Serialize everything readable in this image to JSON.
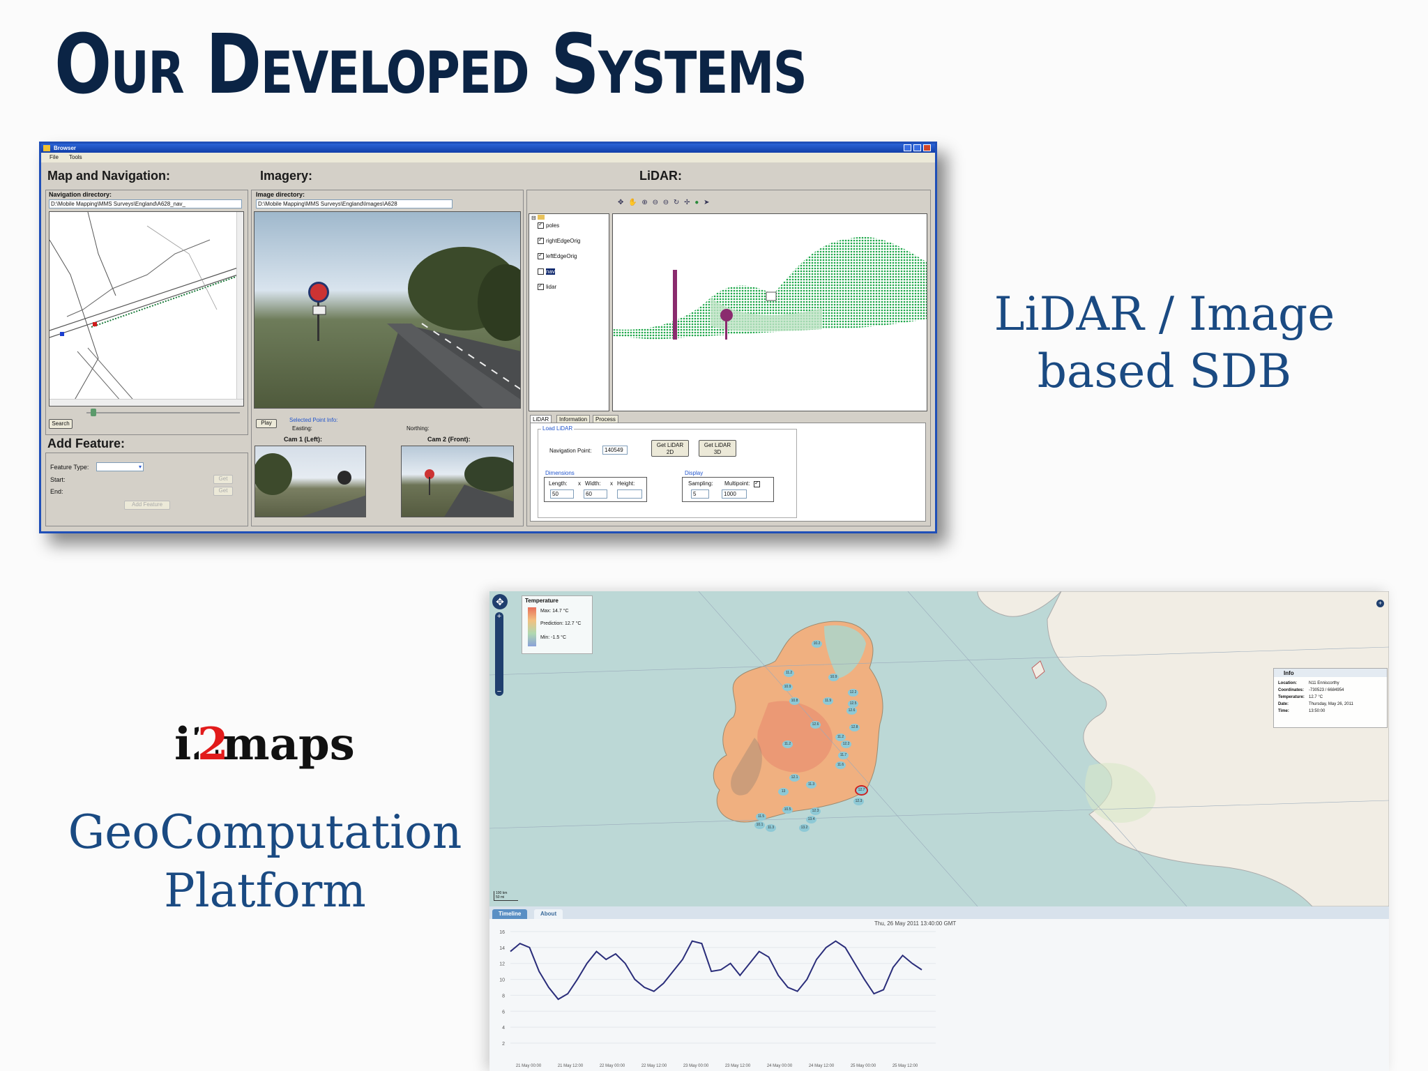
{
  "slide": {
    "title": "Our Developed Systems",
    "lidar_caption_line1": "LiDAR / Image",
    "lidar_caption_line2": "based SDB",
    "i2maps_logo": "i2maps",
    "platform_line1": "GeoComputation",
    "platform_line2": "Platform"
  },
  "browser_app": {
    "window_title": "Browser",
    "menu": [
      "File",
      "Tools"
    ],
    "map_nav": {
      "heading": "Map and Navigation:",
      "dir_label": "Navigation directory:",
      "dir_value": "D:\\Mobile Mapping\\MMS Surveys\\England\\A628_nav_",
      "search_button": "Search"
    },
    "add_feature": {
      "heading": "Add Feature:",
      "feature_type_label": "Feature Type:",
      "start_label": "Start:",
      "end_label": "End:",
      "get_button": "Get",
      "add_button": "Add Feature"
    },
    "imagery": {
      "heading": "Imagery:",
      "dir_label": "Image directory:",
      "dir_value": "D:\\Mobile Mapping\\MMS Surveys\\England\\Images\\A628",
      "play_button": "Play",
      "selected_point_label": "Selected Point Info:",
      "easting_label": "Easting:",
      "northing_label": "Northing:",
      "cam1_label": "Cam 1 (Left):",
      "cam2_label": "Cam 2 (Front):"
    },
    "lidar": {
      "heading": "LiDAR:",
      "layers": [
        {
          "name": "poles",
          "checked": true
        },
        {
          "name": "rightEdgeOrig",
          "checked": true
        },
        {
          "name": "leftEdgeOrig",
          "checked": true
        },
        {
          "name": "nav",
          "checked": false
        },
        {
          "name": "lidar",
          "checked": true
        }
      ],
      "tabs": [
        "LiDAR",
        "Information",
        "Process"
      ],
      "load_group": "Load LiDAR",
      "nav_point_label": "Navigation Point:",
      "nav_point_value": "140549",
      "get2d_line1": "Get LiDAR",
      "get2d_line2": "2D",
      "get3d_line1": "Get LiDAR",
      "get3d_line2": "3D",
      "dimensions_group": "Dimensions",
      "length_label": "Length:",
      "width_label": "Width:",
      "height_label": "Height:",
      "x_sep": "x",
      "length_value": "50",
      "width_value": "60",
      "height_value": "",
      "display_group": "Display",
      "sampling_label": "Sampling:",
      "sampling_value": "5",
      "multipoint_label": "Multipoint:",
      "multipoint_value": "1000"
    }
  },
  "i2maps_app": {
    "legend": {
      "title": "Temperature",
      "max": "Max: 14.7 °C",
      "prediction": "Prediction: 12.7 °C",
      "min": "Min: -1.5 °C"
    },
    "info": {
      "title": "Info",
      "rows": [
        {
          "k": "Location:",
          "v": "N11 Enniscorthy"
        },
        {
          "k": "Coordinates:",
          "v": "-730523 / 6684954"
        },
        {
          "k": "Temperature:",
          "v": "12.7 °C"
        },
        {
          "k": "Date:",
          "v": "Thursday, May 26, 2011"
        },
        {
          "k": "Time:",
          "v": "13:50:00"
        }
      ]
    },
    "scale_top": "100 km",
    "scale_bottom": "50 mi",
    "map_labels": [
      "10.2",
      "11.2",
      "10.9",
      "12.2",
      "10.9",
      "10.8",
      "11.9",
      "12.5",
      "12.6",
      "12.8",
      "11.2",
      "11.2",
      "11.7",
      "12.6",
      "12.2",
      "11.6",
      "12.1",
      "11.3",
      "13",
      "12.7",
      "12.3",
      "10.5",
      "12.3",
      "13.4",
      "13.2",
      "11.5",
      "10.1",
      "11.3"
    ],
    "timeline": {
      "tabs": [
        "Timeline",
        "About"
      ],
      "timestamp": "Thu, 26 May 2011 13:40:00 GMT"
    }
  },
  "chart_data": {
    "type": "line",
    "title": "",
    "xlabel": "",
    "ylabel": "",
    "ylim": [
      2,
      16
    ],
    "y_ticks": [
      2,
      4,
      6,
      8,
      10,
      12,
      14,
      16
    ],
    "x_tick_labels": [
      "21 May 00:00",
      "21 May 12:00",
      "22 May 00:00",
      "22 May 12:00",
      "23 May 00:00",
      "23 May 12:00",
      "24 May 00:00",
      "24 May 12:00",
      "25 May 00:00",
      "25 May 12:00"
    ],
    "series": [
      {
        "values": [
          13.5,
          14.5,
          14,
          11,
          9,
          7.5,
          8.2,
          10,
          12,
          13.5,
          12.5,
          13.2,
          12,
          10,
          9,
          8.5,
          9.5,
          11,
          12.5,
          14.8,
          14.5,
          11,
          11.2,
          12,
          10.5,
          12,
          13.5,
          12.8,
          10.5,
          9,
          8.5,
          10,
          12.5,
          14,
          14.8,
          14,
          12,
          10,
          8.2,
          8.7,
          11.5,
          13,
          12,
          11.2
        ]
      }
    ]
  }
}
